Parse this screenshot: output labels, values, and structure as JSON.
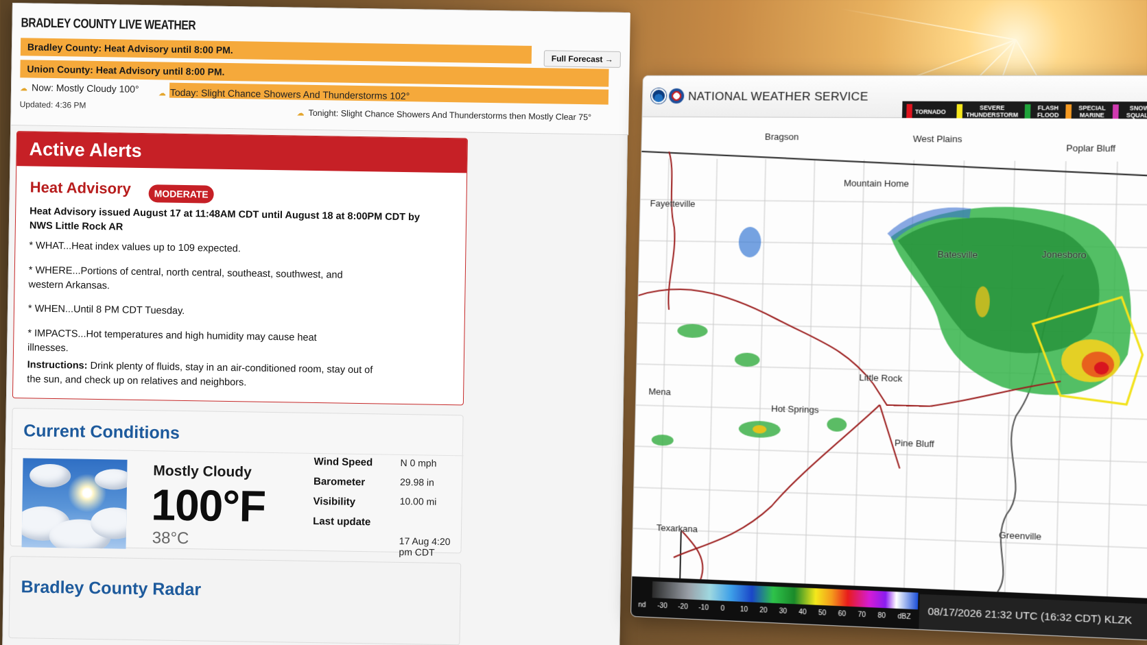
{
  "site": {
    "title": "BRADLEY COUNTY LIVE WEATHER",
    "full_forecast_label": "Full Forecast →"
  },
  "advisories": [
    "Bradley County: Heat Advisory until 8:00 PM.",
    "Union County: Heat Advisory until 8:00 PM."
  ],
  "forecast": {
    "now": "Now: Mostly Cloudy 100°",
    "today": "Today: Slight Chance Showers And Thunderstorms 102°",
    "tonight": "Tonight: Slight Chance Showers And Thunderstorms then Mostly Clear 75°",
    "updated": "Updated: 4:36 PM"
  },
  "alerts": {
    "header": "Active Alerts",
    "title": "Heat Advisory",
    "severity": "MODERATE",
    "issued": "Heat Advisory issued August 17 at 11:48AM CDT until August 18 at 8:00PM CDT by NWS Little Rock AR",
    "what": "* WHAT...Heat index values up to 109 expected.",
    "where": "* WHERE...Portions of central, north central, southeast, southwest, and western Arkansas.",
    "when": "* WHEN...Until 8 PM CDT Tuesday.",
    "impacts": "* IMPACTS...Hot temperatures and high humidity may cause heat illnesses.",
    "instructions_label": "Instructions:",
    "instructions": "Drink plenty of fluids, stay in an air-conditioned room, stay out of the sun, and check up on relatives and neighbors."
  },
  "current": {
    "header": "Current Conditions",
    "condition": "Mostly Cloudy",
    "temp_f": "100°F",
    "temp_c": "38°C",
    "rows": [
      {
        "label": "Wind Speed",
        "value": "N 0 mph"
      },
      {
        "label": "Barometer",
        "value": "29.98 in"
      },
      {
        "label": "Visibility",
        "value": "10.00 mi"
      },
      {
        "label": "Last update",
        "value": "17 Aug 4:20 pm CDT"
      }
    ]
  },
  "radar_section": {
    "header": "Bradley County Radar"
  },
  "map": {
    "title": "NATIONAL WEATHER SERVICE",
    "legend": [
      {
        "label": "TORNADO",
        "color": "#e0141e"
      },
      {
        "label": "SEVERE THUNDERSTORM",
        "color": "#f7e81b"
      },
      {
        "label": "FLASH FLOOD",
        "color": "#1fa33a"
      },
      {
        "label": "SPECIAL MARINE",
        "color": "#f59a22"
      },
      {
        "label": "SNOW SQUALL",
        "color": "#d03ab0"
      }
    ],
    "cities": [
      "Bragson",
      "West Plains",
      "Poplar Bluff",
      "Mountain Home",
      "Fayetteville",
      "Batesville",
      "Jonesboro",
      "Little Rock",
      "Mena",
      "Hot Springs",
      "Pine Bluff",
      "Texarkana",
      "Greenville"
    ],
    "scale": [
      "nd",
      "-30",
      "-20",
      "-10",
      "0",
      "10",
      "20",
      "30",
      "40",
      "50",
      "60",
      "70",
      "80",
      "dBZ"
    ],
    "timestamp": "08/17/2026 21:32 UTC (16:32 CDT)  KLZK"
  }
}
